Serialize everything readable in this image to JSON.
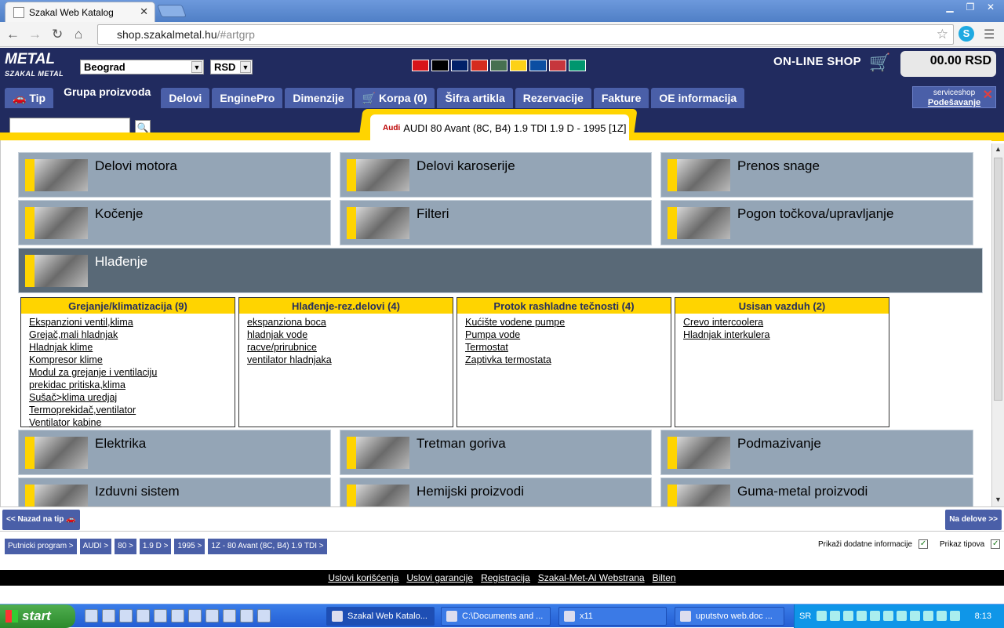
{
  "browser": {
    "tab_title": "Szakal Web Katalog",
    "close_glyph": "✕",
    "url_host": "shop.szakalmetal.hu",
    "url_path": "/#artgrp",
    "skype_letter": "S"
  },
  "header": {
    "logo_top": "METAL",
    "logo_bottom": "SZAKAL METAL",
    "city_select": "Beograd",
    "currency_select": "RSD",
    "shop_label": "ON-LINE SHOP",
    "cart_total": "00.00 RSD",
    "service_top": "serviceshop",
    "service_label": "Podešavanje",
    "flag_colors": [
      "#d7141a",
      "#000000",
      "#012169",
      "#d52b1e",
      "#477050",
      "#fcd116",
      "#0b4ea2",
      "#c6363c",
      "#00966e"
    ]
  },
  "menu": {
    "tabs": [
      "Tip",
      "Grupa proizvoda",
      "Delovi",
      "EnginePro",
      "Dimenzije",
      "Korpa (0)",
      "Šifra artikla",
      "Rezervacije",
      "Fakture",
      "OE informacija"
    ],
    "active_index": 1
  },
  "vehicle": {
    "brand_badge": "Audi",
    "label": "AUDI 80 Avant (8C, B4) 1.9 TDI 1.9 D - 1995 [1Z]"
  },
  "categories": {
    "row1": [
      "Delovi motora",
      "Delovi karoserije",
      "Prenos snage"
    ],
    "row2": [
      "Kočenje",
      "Filteri",
      "Pogon točkova/upravljanje"
    ],
    "open": "Hlađenje",
    "row4": [
      "Elektrika",
      "Tretman goriva",
      "Podmazivanje"
    ],
    "row5": [
      "Izduvni sistem",
      "Hemijski proizvodi",
      "Guma-metal proizvodi"
    ]
  },
  "subgroups": [
    {
      "title": "Grejanje/klimatizacija (9)",
      "items": [
        "Ekspanzioni ventil,klima",
        "Grejač,mali hladnjak",
        "Hladnjak klime",
        "Kompresor klime",
        "Modul za grejanje i ventilaciju",
        "prekidac pritiska,klima",
        "Sušač>klima uredjaj",
        "Termoprekidač,ventilator",
        "Ventilator kabine"
      ]
    },
    {
      "title": "Hlađenje-rez.delovi (4)",
      "items": [
        "ekspanziona boca",
        "hladnjak vode",
        "racve/prirubnice",
        "ventilator hladnjaka"
      ]
    },
    {
      "title": "Protok rashladne tečnosti (4)",
      "items": [
        "Kućište vodene pumpe",
        "Pumpa vode",
        "Termostat",
        "Zaptivka termostata"
      ]
    },
    {
      "title": "Usisan vazduh (2)",
      "items": [
        "Crevo intercoolera",
        "Hladnjak interkulera"
      ]
    }
  ],
  "nav": {
    "back": "<< Nazad na tip",
    "forward": "Na delove >>"
  },
  "breadcrumbs": [
    "Putnicki program >",
    "AUDI >",
    "80 >",
    "1.9 D >",
    "1995 >",
    "1Z - 80 Avant (8C, B4) 1.9 TDI >"
  ],
  "options": {
    "extra_info": "Prikaži dodatne informacije",
    "show_types": "Prikaz tipova"
  },
  "footer": [
    "Uslovi korišćenja",
    "Uslovi garancije",
    "Registracija",
    "Szakal-Met-Al Webstrana",
    "Bilten"
  ],
  "taskbar": {
    "start": "start",
    "windows": [
      "Szakal Web Katalo...",
      "C:\\Documents and ...",
      "x11",
      "uputstvo web.doc ..."
    ],
    "lang": "SR",
    "clock": "8:13"
  }
}
